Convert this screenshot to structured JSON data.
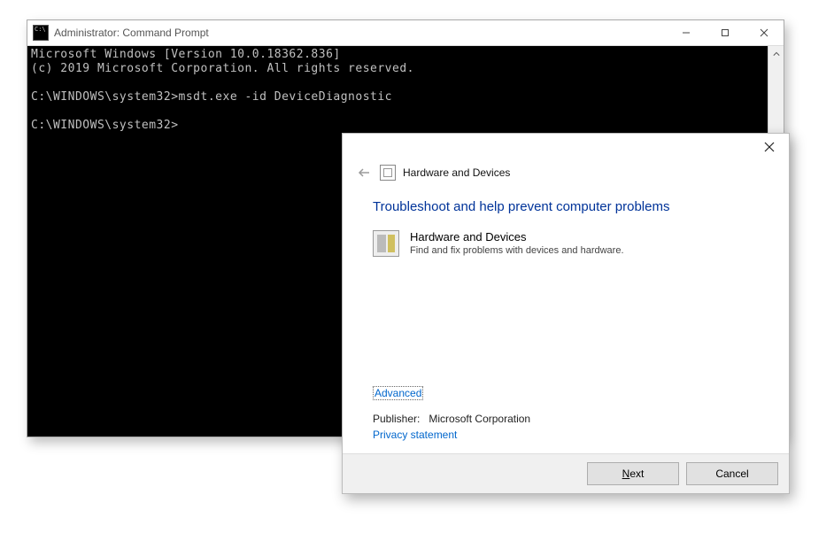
{
  "cmd": {
    "title": "Administrator: Command Prompt",
    "lines": [
      "Microsoft Windows [Version 10.0.18362.836]",
      "(c) 2019 Microsoft Corporation. All rights reserved.",
      "",
      "C:\\WINDOWS\\system32>msdt.exe -id DeviceDiagnostic",
      "",
      "C:\\WINDOWS\\system32>"
    ]
  },
  "ts": {
    "header_title": "Hardware and Devices",
    "heading": "Troubleshoot and help prevent computer problems",
    "item_title": "Hardware and Devices",
    "item_desc": "Find and fix problems with devices and hardware.",
    "advanced": "Advanced",
    "publisher_label": "Publisher:",
    "publisher_value": "Microsoft Corporation",
    "privacy": "Privacy statement",
    "next_prefix": "N",
    "next_rest": "ext",
    "cancel": "Cancel"
  }
}
